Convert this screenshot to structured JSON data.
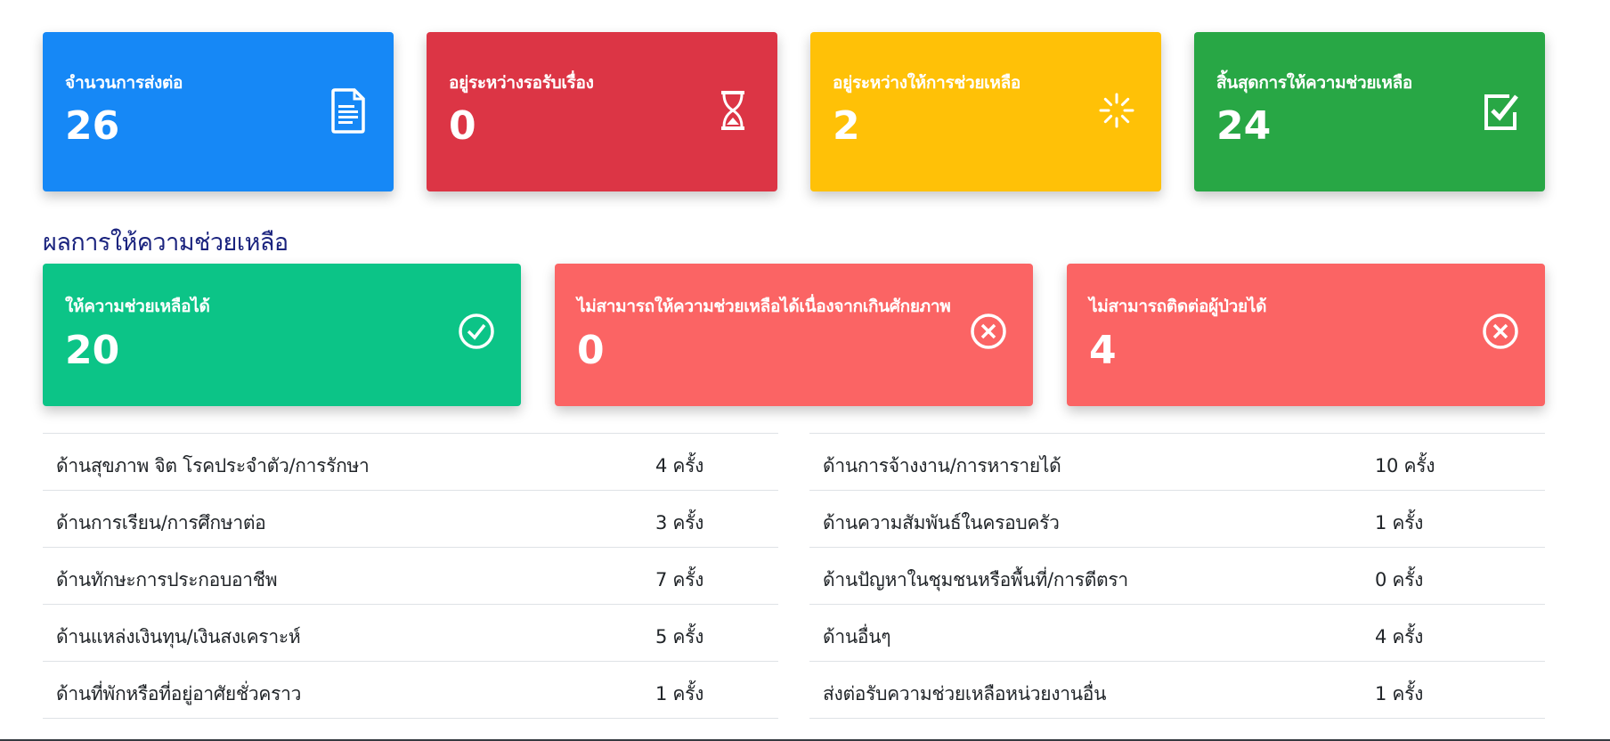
{
  "stats": [
    {
      "label": "จำนวนการส่งต่อ",
      "value": "26",
      "icon": "document-icon",
      "color": "#1688f6"
    },
    {
      "label": "อยู่ระหว่างรอรับเรื่อง",
      "value": "0",
      "icon": "hourglass-icon",
      "color": "#dc3545"
    },
    {
      "label": "อยู่ระหว่างให้การช่วยเหลือ",
      "value": "2",
      "icon": "spinner-icon",
      "color": "#ffc107"
    },
    {
      "label": "สิ้นสุดการให้ความช่วยเหลือ",
      "value": "24",
      "icon": "check-square-icon",
      "color": "#28a745"
    }
  ],
  "results_title": "ผลการให้ความช่วยเหลือ",
  "results": [
    {
      "label": "ให้ความช่วยเหลือได้",
      "value": "20",
      "icon": "check-circle-icon",
      "color": "#0cc487"
    },
    {
      "label": "ไม่สามารถให้ความช่วยเหลือได้เนื่องจากเกินศักยภาพ",
      "value": "0",
      "icon": "x-circle-icon",
      "color": "#fb6464"
    },
    {
      "label": "ไม่สามารถติดต่อผู้ป่วยได้",
      "value": "4",
      "icon": "x-circle-icon",
      "color": "#fb6464"
    }
  ],
  "categories_left": [
    {
      "name": "ด้านสุขภาพ จิต โรคประจำตัว/การรักษา",
      "count": "4 ครั้ง"
    },
    {
      "name": "ด้านการเรียน/การศึกษาต่อ",
      "count": "3 ครั้ง"
    },
    {
      "name": "ด้านทักษะการประกอบอาชีพ",
      "count": "7 ครั้ง"
    },
    {
      "name": "ด้านแหล่งเงินทุน/เงินสงเคราะห์",
      "count": "5 ครั้ง"
    },
    {
      "name": "ด้านที่พักหรือที่อยู่อาศัยชั่วคราว",
      "count": "1 ครั้ง"
    }
  ],
  "categories_right": [
    {
      "name": "ด้านการจ้างงาน/การหารายได้",
      "count": "10 ครั้ง"
    },
    {
      "name": "ด้านความสัมพันธ์ในครอบครัว",
      "count": "1 ครั้ง"
    },
    {
      "name": "ด้านปัญหาในชุมชนหรือพื้นที่/การตีตรา",
      "count": "0 ครั้ง"
    },
    {
      "name": "ด้านอื่นๆ",
      "count": "4 ครั้ง"
    },
    {
      "name": "ส่งต่อรับความช่วยเหลือหน่วยงานอื่น",
      "count": "1 ครั้ง"
    }
  ]
}
